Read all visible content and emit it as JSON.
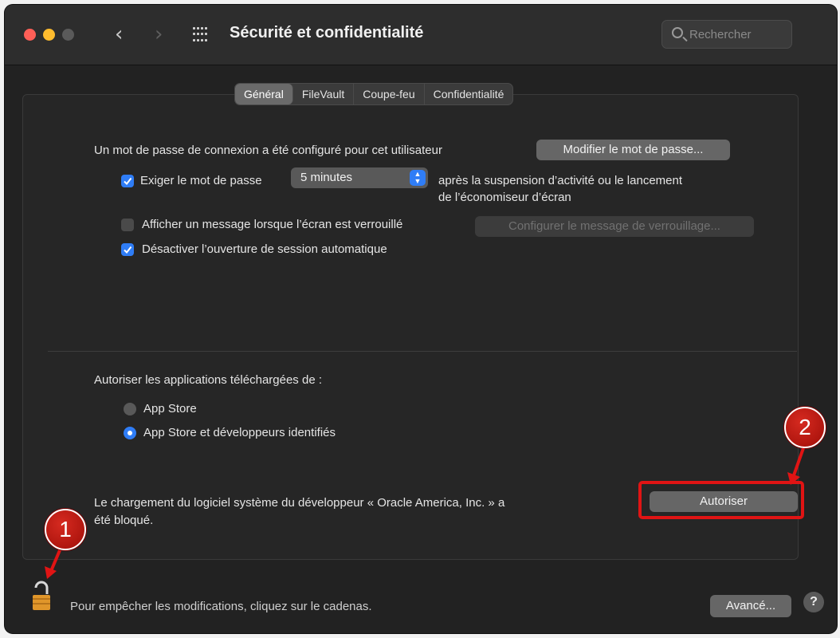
{
  "window": {
    "title": "Sécurité et confidentialité",
    "search_placeholder": "Rechercher"
  },
  "tabs": [
    {
      "label": "Général",
      "active": true
    },
    {
      "label": "FileVault",
      "active": false
    },
    {
      "label": "Coupe-feu",
      "active": false
    },
    {
      "label": "Confidentialité",
      "active": false
    }
  ],
  "general": {
    "password_configured_text": "Un mot de passe de connexion a été configuré pour cet utilisateur",
    "change_password_button": "Modifier le mot de passe...",
    "require_password_label": "Exiger le mot de passe",
    "require_password_checked": true,
    "require_password_delay": "5 minutes",
    "require_password_suffix_line1": "après la suspension d’activité ou le lancement",
    "require_password_suffix_line2": "de l’économiseur d’écran",
    "show_message_label": "Afficher un message lorsque l’écran est verrouillé",
    "show_message_checked": false,
    "set_lock_message_button": "Configurer le message de verrouillage...",
    "disable_auto_login_label": "Désactiver l’ouverture de session automatique",
    "disable_auto_login_checked": true
  },
  "downloads": {
    "heading": "Autoriser les applications téléchargées de :",
    "options": [
      {
        "label": "App Store",
        "selected": false
      },
      {
        "label": "App Store et développeurs identifiés",
        "selected": true
      }
    ]
  },
  "blocked": {
    "message_line1": "Le chargement du logiciel système du développeur « Oracle America, Inc. » a",
    "message_line2": "été bloqué.",
    "allow_button": "Autoriser"
  },
  "footer": {
    "lock_text": "Pour empêcher les modifications, cliquez sur le cadenas.",
    "advanced_button": "Avancé...",
    "help_label": "?"
  },
  "annotations": {
    "badge_1": "1",
    "badge_2": "2",
    "color": "#e01414"
  }
}
